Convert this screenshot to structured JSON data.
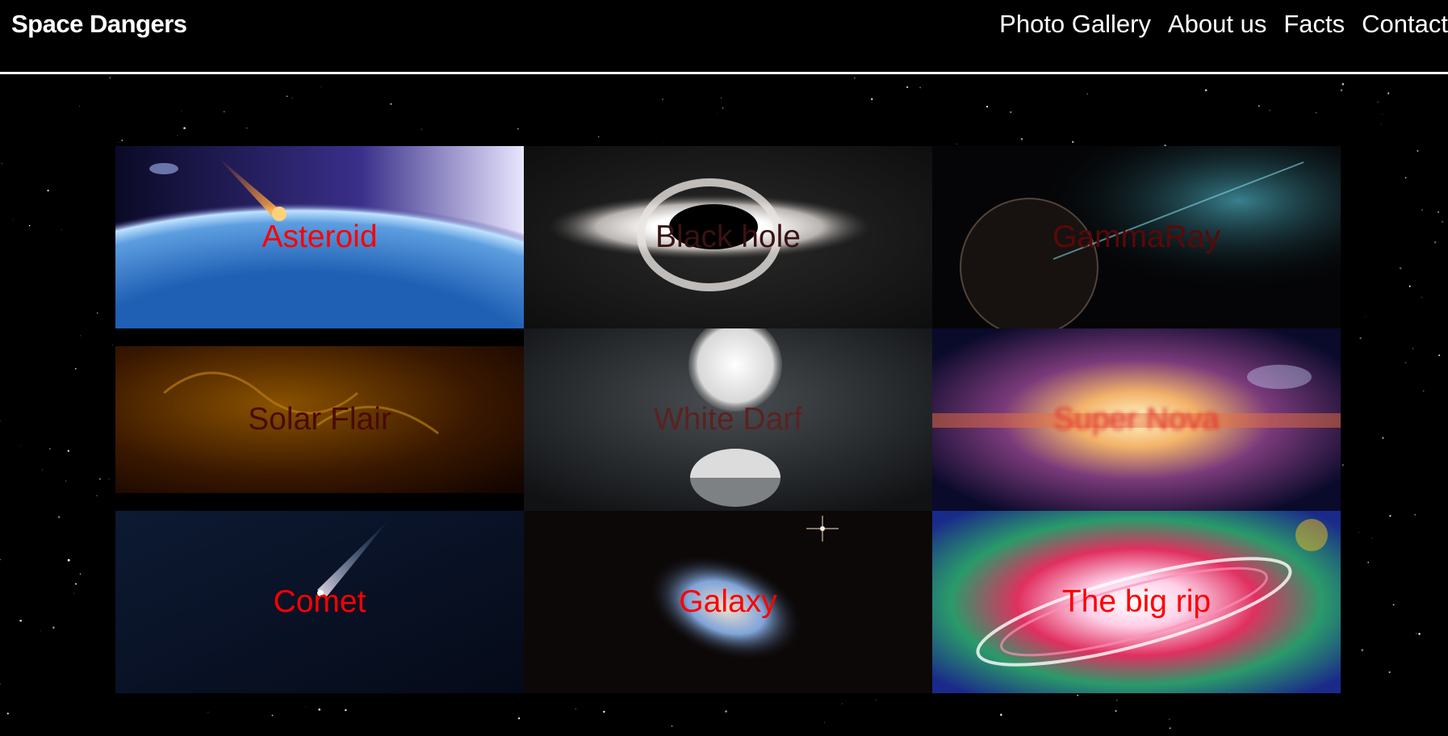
{
  "header": {
    "brand": "Space Dangers",
    "nav": [
      "Photo Gallery",
      "About us",
      "Facts",
      "Contact"
    ]
  },
  "gallery": {
    "tiles": [
      {
        "label": "Asteroid",
        "icon": "asteroid-image"
      },
      {
        "label": "Black hole",
        "icon": "black-hole-image"
      },
      {
        "label": "GammaRay",
        "icon": "gamma-ray-image"
      },
      {
        "label": "Solar Flair",
        "icon": "solar-flare-image"
      },
      {
        "label": "White Darf",
        "icon": "white-dwarf-image"
      },
      {
        "label": "Super Nova",
        "icon": "supernova-image"
      },
      {
        "label": "Comet",
        "icon": "comet-image"
      },
      {
        "label": "Galaxy",
        "icon": "galaxy-image"
      },
      {
        "label": "The big rip",
        "icon": "big-rip-image"
      }
    ]
  },
  "colors": {
    "background": "#000000",
    "text": "#ffffff",
    "label": "#ff0000"
  }
}
